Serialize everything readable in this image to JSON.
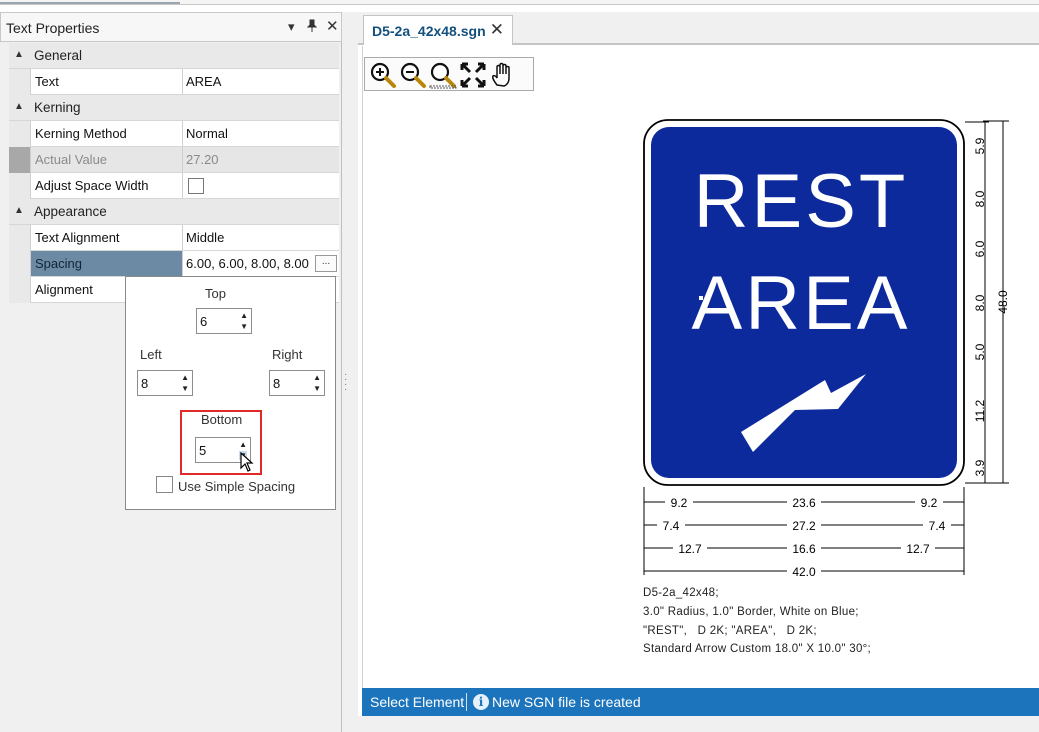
{
  "panel": {
    "title": "Text Properties",
    "pin_icon": "pin-icon",
    "close_icon": "close-icon",
    "dropdown_icon": "chevron-down-icon"
  },
  "properties": {
    "general": {
      "label": "General",
      "text_label": "Text",
      "text_value": "AREA"
    },
    "kerning": {
      "label": "Kerning",
      "method_label": "Kerning Method",
      "method_value": "Normal",
      "actual_label": "Actual Value",
      "actual_value": "27.20",
      "adjust_label": "Adjust Space Width"
    },
    "appearance": {
      "label": "Appearance",
      "alignment_label": "Text Alignment",
      "alignment_value": "Middle",
      "spacing_label": "Spacing",
      "spacing_value": "6.00, 6.00, 8.00, 8.00",
      "spacing_button": "...",
      "alignment2_label": "Alignment"
    }
  },
  "spacing_popup": {
    "top_label": "Top",
    "top_value": "6",
    "left_label": "Left",
    "left_value": "8",
    "right_label": "Right",
    "right_value": "8",
    "bottom_label": "Bottom",
    "bottom_value": "5",
    "simple_label": "Use Simple Spacing"
  },
  "document": {
    "tab_label": "D5-2a_42x48.sgn",
    "zoom_tools": [
      "zoom-in-icon",
      "zoom-out-icon",
      "zoom-window-icon",
      "fit-view-icon",
      "pan-hand-icon"
    ]
  },
  "sign": {
    "line1": "REST",
    "line2": "AREA",
    "background_color": "#0c2a9c",
    "text_color": "#ffffff",
    "right_dims": [
      "5.9",
      "8.0",
      "6.0",
      "8.0",
      "5.0",
      "11.2",
      "3.9"
    ],
    "height_total": "48.0",
    "bottom_row1": [
      "9.2",
      "23.6",
      "9.2"
    ],
    "bottom_row2": [
      "7.4",
      "27.2",
      "7.4"
    ],
    "bottom_row3": [
      "12.7",
      "16.6",
      "12.7"
    ],
    "width_total": "42.0"
  },
  "caption": [
    "D5-2a_42x48;",
    "3.0\" Radius, 1.0\" Border, White on Blue;",
    "\"REST\",   D 2K; \"AREA\",   D 2K;",
    "Standard Arrow Custom 18.0\" X 10.0\" 30°;"
  ],
  "status": {
    "select_label": "Select Element",
    "message": "New SGN file is created"
  }
}
